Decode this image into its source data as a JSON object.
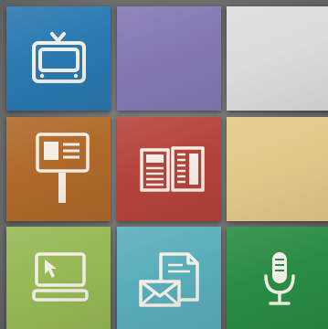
{
  "tiles": [
    {
      "icon": "tv-icon",
      "color": "#2a79b1"
    },
    {
      "icon": "none",
      "color": "#8479b4"
    },
    {
      "icon": "none",
      "color": "#dcdcdc"
    },
    {
      "icon": "signpost-icon",
      "color": "#b06a2a"
    },
    {
      "icon": "newspaper-icon",
      "color": "#b5443b"
    },
    {
      "icon": "none",
      "color": "#e2c98a"
    },
    {
      "icon": "computer-cursor-icon",
      "color": "#97b956"
    },
    {
      "icon": "mail-document-icon",
      "color": "#5aaebb"
    },
    {
      "icon": "microphone-icon",
      "color": "#2a8c43"
    }
  ],
  "icon_color": "#f3eee6"
}
